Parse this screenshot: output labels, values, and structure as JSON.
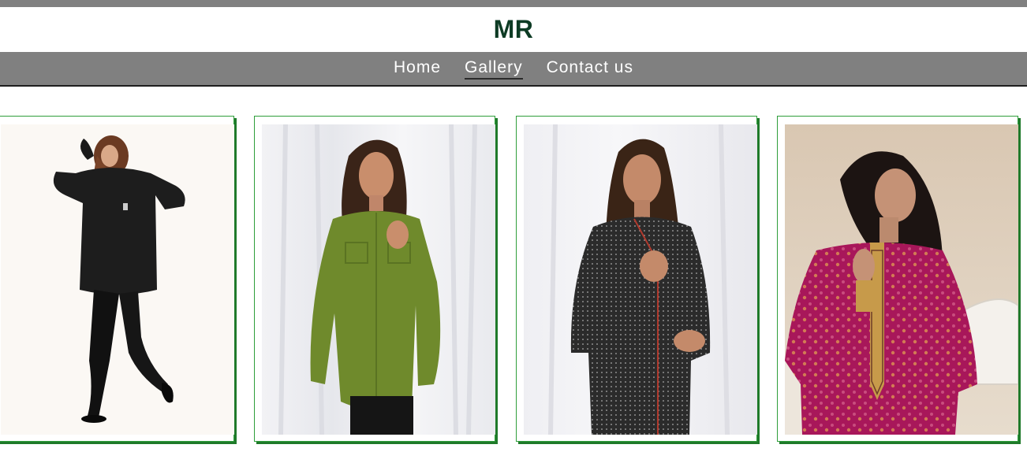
{
  "brand": {
    "logo_text": "MR"
  },
  "nav": {
    "items": [
      {
        "label": "Home",
        "active": false
      },
      {
        "label": "Gallery",
        "active": true
      },
      {
        "label": "Contact us",
        "active": false
      }
    ]
  },
  "gallery": {
    "items": [
      {
        "image": "model-black-top-black-leggings"
      },
      {
        "image": "model-olive-green-shirt"
      },
      {
        "image": "model-black-polka-dot-tunic"
      },
      {
        "image": "model-magenta-embroidered-kurta"
      }
    ]
  },
  "colors": {
    "bar_gray": "#808080",
    "brand_green": "#0d3b24",
    "card_border": "#2e9e3a",
    "card_shadow": "#1f7a2a"
  }
}
